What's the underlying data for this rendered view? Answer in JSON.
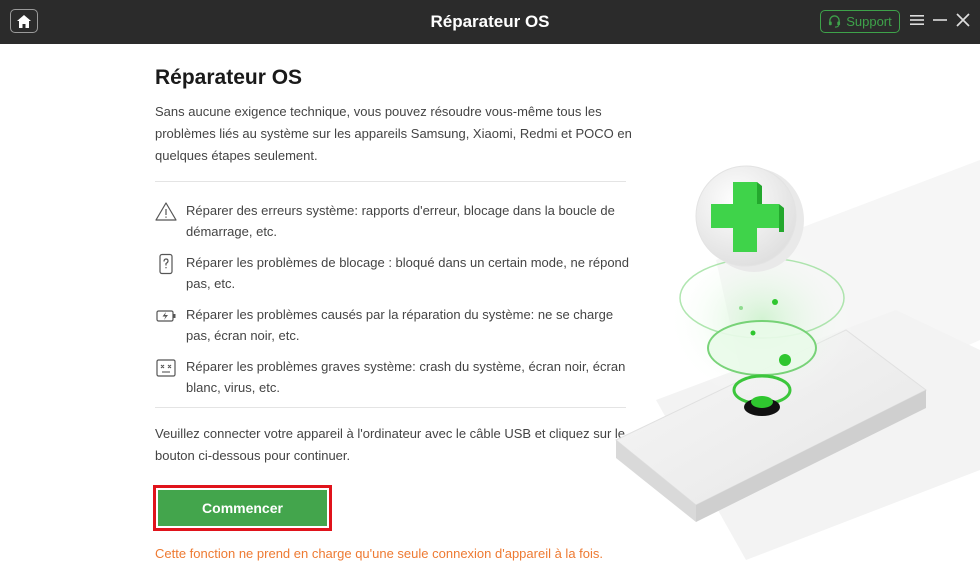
{
  "window": {
    "title": "Réparateur OS",
    "support_label": "Support",
    "icons": {
      "home": "home-icon",
      "support": "headset-icon",
      "menu": "menu-icon",
      "minimize": "minimize-icon",
      "close": "close-icon"
    }
  },
  "main": {
    "title": "Réparateur OS",
    "description": "Sans aucune exigence technique, vous pouvez résoudre vous-même tous les problèmes liés au système sur les appareils Samsung, Xiaomi, Redmi et POCO en quelques étapes seulement.",
    "features": [
      {
        "icon": "warning-icon",
        "text": "Réparer des erreurs système: rapports d'erreur, blocage dans la boucle de démarrage, etc."
      },
      {
        "icon": "phone-question-icon",
        "text": "Réparer les problèmes de blocage : bloqué dans un certain mode, ne répond pas, etc."
      },
      {
        "icon": "battery-charge-icon",
        "text": "Réparer les problèmes causés par la réparation du système: ne se charge pas, écran noir, etc."
      },
      {
        "icon": "broken-screen-icon",
        "text": "Réparer les problèmes graves système: crash du système, écran noir, écran blanc, virus, etc."
      }
    ],
    "instruction": "Veuillez connecter votre appareil à l'ordinateur avec le câble USB et cliquez sur le bouton ci-dessous pour continuer.",
    "start_button": "Commencer",
    "notice": "Cette fonction ne prend en charge qu'une seule connexion d'appareil à la fois."
  },
  "colors": {
    "titlebar": "#2b2b2b",
    "accent_green": "#43a54c",
    "highlight_red": "#e0131b",
    "notice_orange": "#ee7a32"
  }
}
